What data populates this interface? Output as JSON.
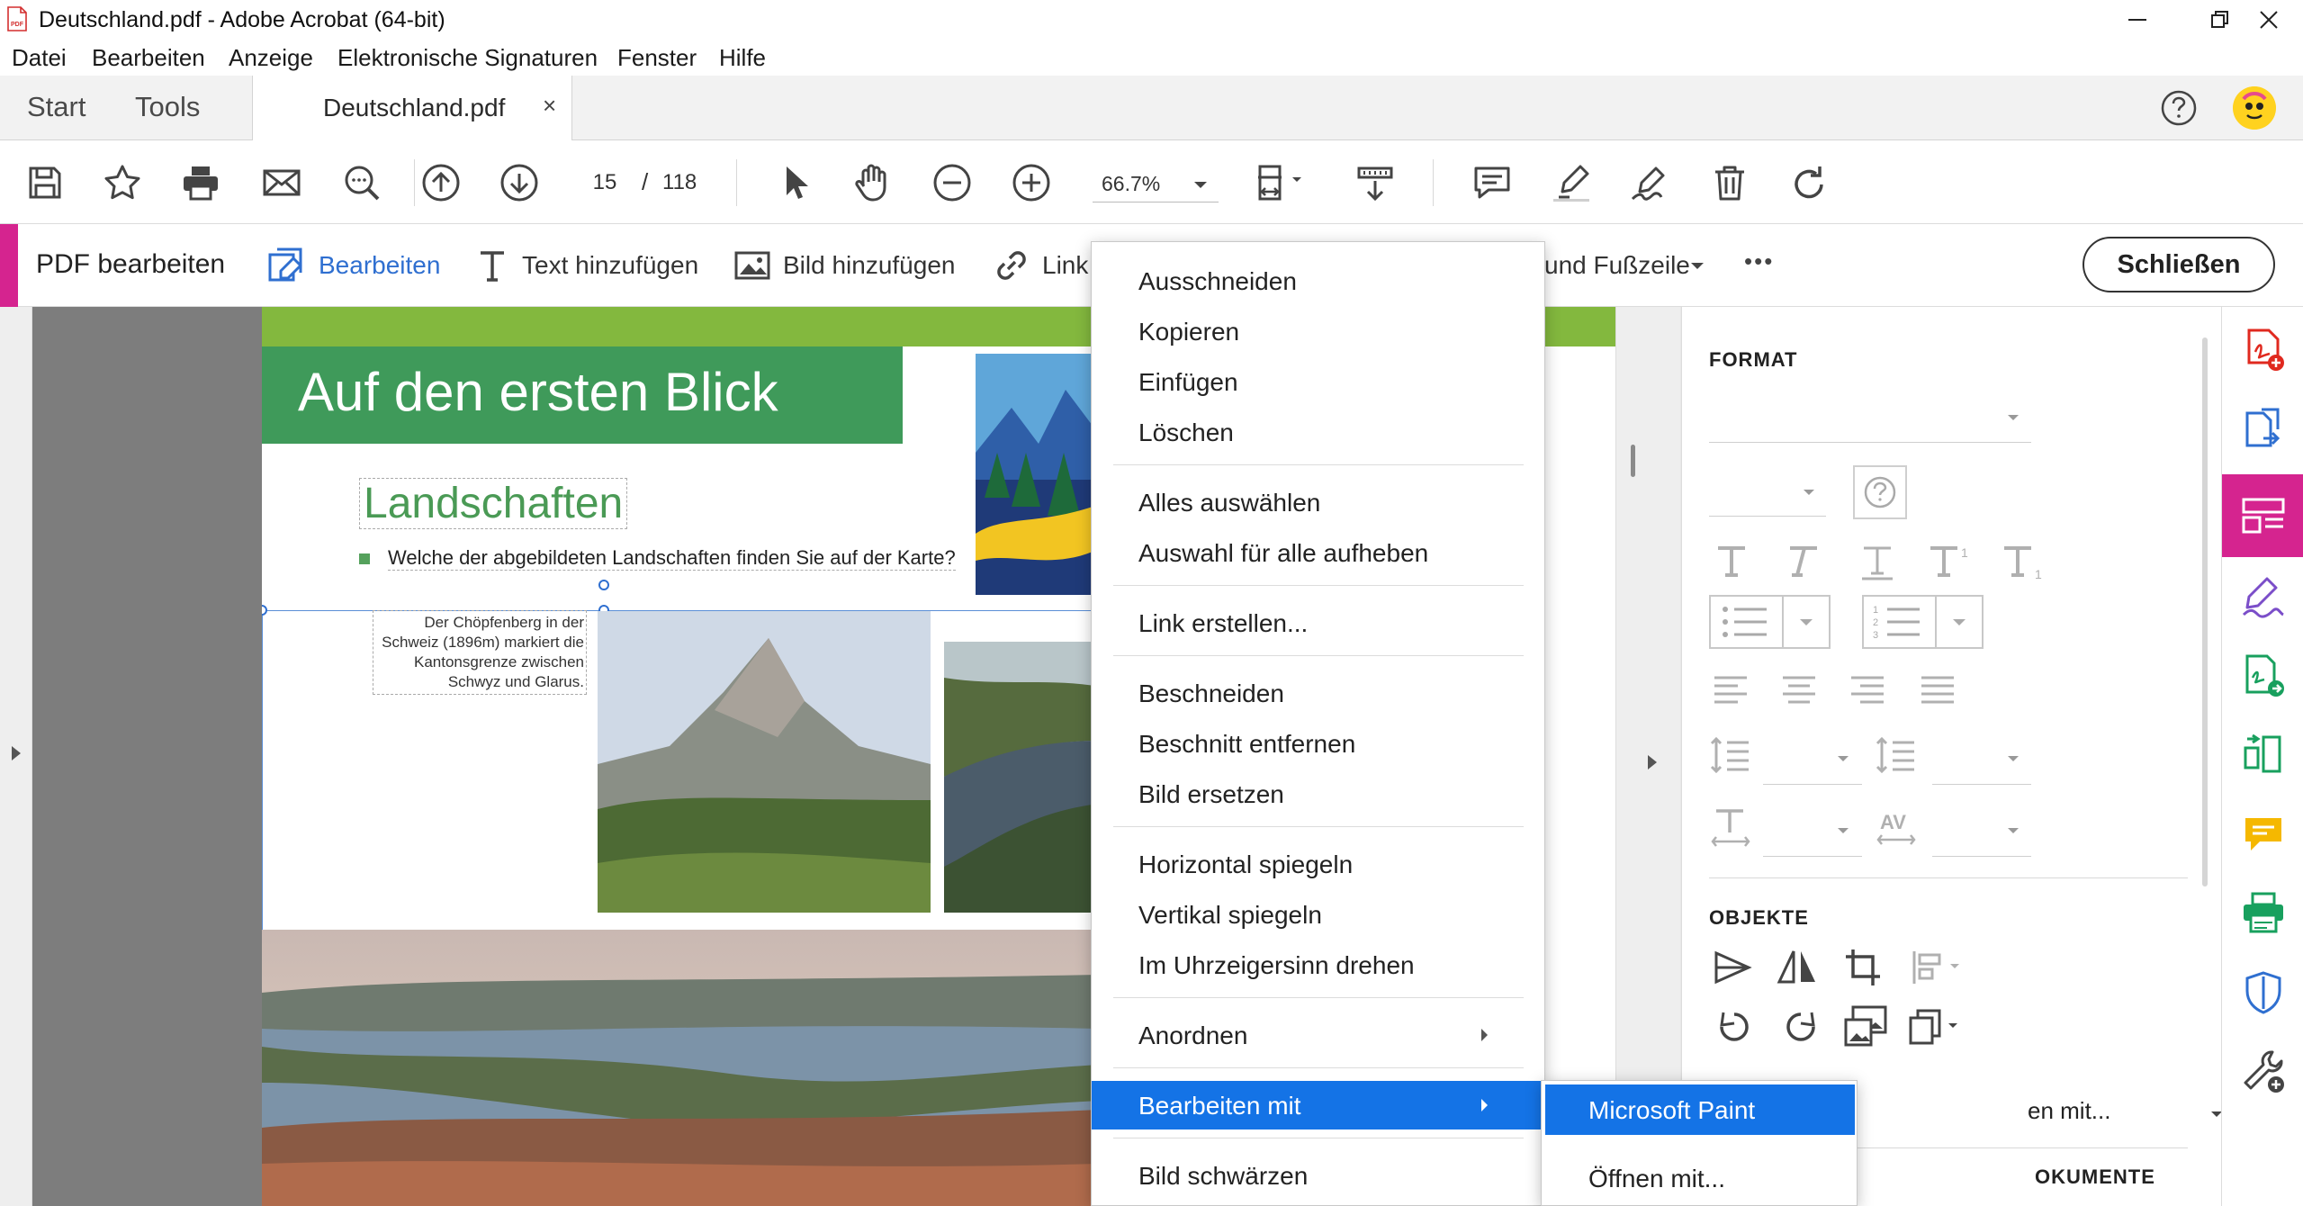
{
  "window": {
    "title": "Deutschland.pdf - Adobe Acrobat (64-bit)"
  },
  "menubar": [
    "Datei",
    "Bearbeiten",
    "Anzeige",
    "Elektronische Signaturen",
    "Fenster",
    "Hilfe"
  ],
  "tabs": {
    "start": "Start",
    "tools": "Tools",
    "document": "Deutschland.pdf",
    "close": "×"
  },
  "toolbar": {
    "current_page": "15",
    "page_separator": "/",
    "total_pages": "118",
    "zoom": "66.7%",
    "icons": [
      "save-icon",
      "bookmark-star-icon",
      "print-icon",
      "email-icon",
      "zoom-search-icon",
      "page-up-icon",
      "page-down-icon",
      "select-arrow-icon",
      "hand-tool-icon",
      "zoom-out-icon",
      "zoom-in-icon",
      "fit-page-icon",
      "scroll-mode-icon",
      "comment-icon",
      "highlight-icon",
      "sign-icon",
      "delete-icon",
      "rotate-icon"
    ]
  },
  "editbar": {
    "title": "PDF bearbeiten",
    "edit": "Bearbeiten",
    "add_text": "Text hinzufügen",
    "add_image": "Bild hinzufügen",
    "link": "Link",
    "header_footer": "und Fußzeile",
    "more": "•••",
    "close": "Schließen"
  },
  "document": {
    "banner_title": "Auf den ersten Blick",
    "heading": "Landschaften",
    "question": "Welche der abgebildeten Landschaften finden Sie auf der Karte?",
    "caption": "Der Chöpfenberg in der Schweiz (1896m) markiert die Kantonsgrenze zwischen Schwyz und Glarus."
  },
  "context_menu": {
    "items": [
      {
        "label": "Ausschneiden",
        "u": "A"
      },
      {
        "label": "Kopieren",
        "u": "K"
      },
      {
        "label": "Einfügen",
        "u": "E"
      },
      {
        "label": "Löschen",
        "u": "L"
      },
      {
        "label": "Alles auswählen"
      },
      {
        "label": "Auswahl für alle aufheben"
      },
      {
        "label": "Link erstellen..."
      },
      {
        "label": "Beschneiden"
      },
      {
        "label": "Beschnitt entfernen"
      },
      {
        "label": "Bild ersetzen"
      },
      {
        "label": "Horizontal spiegeln"
      },
      {
        "label": "Vertikal spiegeln"
      },
      {
        "label": "Im Uhrzeigersinn drehen"
      },
      {
        "label": "Anordnen",
        "submenu": true
      },
      {
        "label": "Bearbeiten mit",
        "submenu": true,
        "active": true
      },
      {
        "label": "Bild schwärzen"
      }
    ]
  },
  "submenu": {
    "items": [
      {
        "label": "Microsoft Paint",
        "active": true
      },
      {
        "label": "Öffnen mit..."
      }
    ]
  },
  "right_panel": {
    "format_title": "FORMAT",
    "objects_title": "OBJEKTE",
    "partial_edit_with": "en mit...",
    "partial_documents": "OKUMENTE"
  },
  "tool_rail": [
    "create-pdf-icon",
    "export-pdf-icon",
    "edit-pdf-icon",
    "fill-sign-icon",
    "send-for-review-icon",
    "organize-pages-icon",
    "comment-icon",
    "print-production-icon",
    "protect-icon",
    "more-tools-icon"
  ],
  "colors": {
    "accent_pink": "#d5248f",
    "selection_blue": "#1473e6",
    "acrobat_red": "#e0291f",
    "tool_blue": "#2f6fd0",
    "banner_green": "#3f9a5a"
  }
}
